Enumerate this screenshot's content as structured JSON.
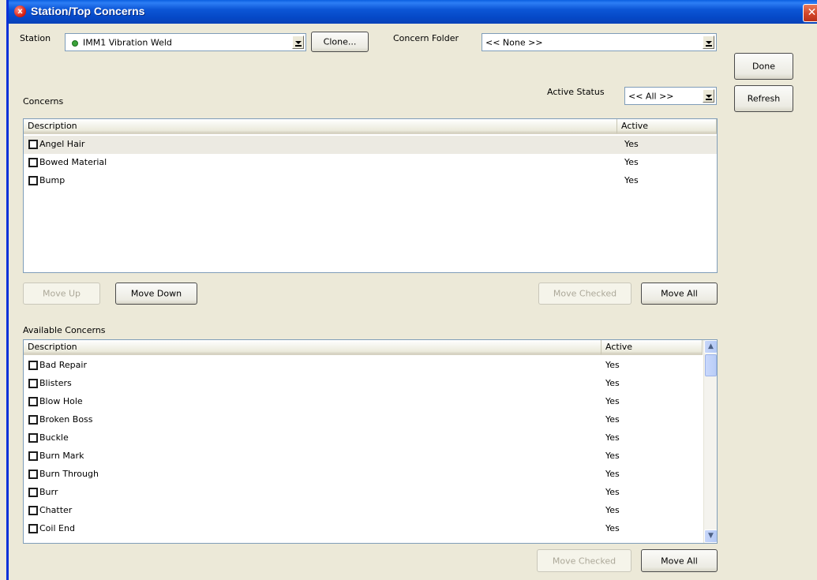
{
  "window": {
    "title": "Station/Top Concerns",
    "close_glyph": "✕"
  },
  "station": {
    "label": "Station",
    "value": "IMM1 Vibration Weld",
    "status_color": "#3aa33a",
    "clone_label": "Clone..."
  },
  "concern_folder": {
    "label": "Concern Folder",
    "value": "<< None >>"
  },
  "active_status": {
    "label": "Active Status",
    "value": "<< All >>"
  },
  "actions": {
    "done_label": "Done",
    "refresh_label": "Refresh"
  },
  "concerns": {
    "title": "Concerns",
    "columns": {
      "description": "Description",
      "active": "Active"
    },
    "rows": [
      {
        "description": "Angel Hair",
        "active": "Yes"
      },
      {
        "description": "Bowed Material",
        "active": "Yes"
      },
      {
        "description": "Bump",
        "active": "Yes"
      }
    ],
    "move_up_label": "Move Up",
    "move_down_label": "Move Down",
    "move_checked_label": "Move Checked",
    "move_all_label": "Move All"
  },
  "available": {
    "title": "Available Concerns",
    "columns": {
      "description": "Description",
      "active": "Active"
    },
    "rows": [
      {
        "description": "Bad Repair",
        "active": "Yes"
      },
      {
        "description": "Blisters",
        "active": "Yes"
      },
      {
        "description": "Blow Hole",
        "active": "Yes"
      },
      {
        "description": "Broken Boss",
        "active": "Yes"
      },
      {
        "description": "Buckle",
        "active": "Yes"
      },
      {
        "description": "Burn Mark",
        "active": "Yes"
      },
      {
        "description": "Burn Through",
        "active": "Yes"
      },
      {
        "description": "Burr",
        "active": "Yes"
      },
      {
        "description": "Chatter",
        "active": "Yes"
      },
      {
        "description": "Coil End",
        "active": "Yes"
      }
    ],
    "move_checked_label": "Move Checked",
    "move_all_label": "Move All"
  }
}
